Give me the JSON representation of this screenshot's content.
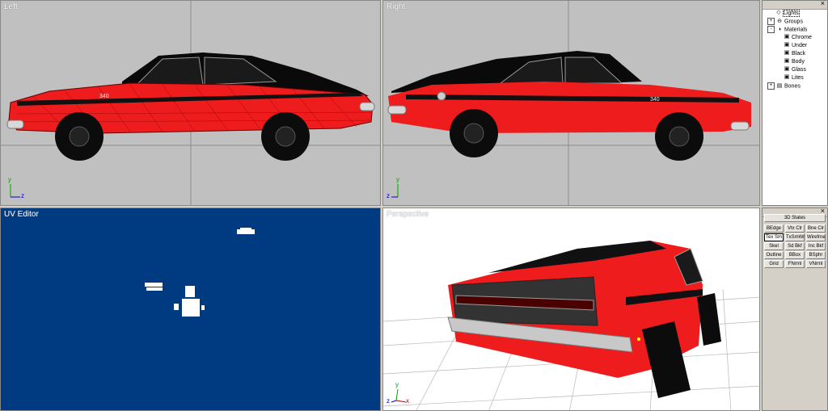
{
  "viewports": {
    "left": {
      "label": "Left",
      "axis_y": "y",
      "axis_z": "z"
    },
    "right": {
      "label": "Right",
      "axis_y": "y",
      "axis_z": "z"
    },
    "uv": {
      "label": "UV Editor"
    },
    "perspective": {
      "label": "Perspective",
      "axis_y": "y",
      "axis_z": "z",
      "axis_x": "x"
    }
  },
  "car_badge_left": "340",
  "car_badge_right": "340",
  "scene_tree": {
    "items": [
      {
        "label": "Lights",
        "icon": "light-icon",
        "expander": "",
        "indent": 1,
        "selected": true
      },
      {
        "label": "Groups",
        "icon": "groups-icon",
        "expander": "+",
        "indent": 0
      },
      {
        "label": "Materials",
        "icon": "material-icon",
        "expander": "-",
        "indent": 0
      },
      {
        "label": "Chrome",
        "icon": "texture-icon",
        "expander": "",
        "indent": 2
      },
      {
        "label": "Under",
        "icon": "texture-icon",
        "expander": "",
        "indent": 2
      },
      {
        "label": "Black",
        "icon": "texture-icon",
        "expander": "",
        "indent": 2
      },
      {
        "label": "Body",
        "icon": "texture-icon",
        "expander": "",
        "indent": 2
      },
      {
        "label": "Glass",
        "icon": "texture-icon",
        "expander": "",
        "indent": 2
      },
      {
        "label": "Lites",
        "icon": "texture-icon",
        "expander": "",
        "indent": 2
      },
      {
        "label": "Bones",
        "icon": "bones-icon",
        "expander": "+",
        "indent": 0
      }
    ]
  },
  "states_panel": {
    "title": "3D States",
    "buttons": [
      [
        "BEdge",
        "Vtx Clr",
        "Bne Clr"
      ],
      [
        "Tex Sm",
        "TxSmWr",
        "Wirefrne"
      ],
      [
        "Skel",
        "Sd Bkf",
        "Inc Bkf"
      ],
      [
        "Outline",
        "BBox",
        "BSphr"
      ],
      [
        "Grid",
        "FNrml",
        "VNrml"
      ]
    ],
    "active": "Tex Sm"
  },
  "colors": {
    "viewport_bg": "#c0c0c0",
    "uv_bg": "#003b82",
    "car_red": "#ee1c1c",
    "grid_line": "#8c8c8c"
  }
}
